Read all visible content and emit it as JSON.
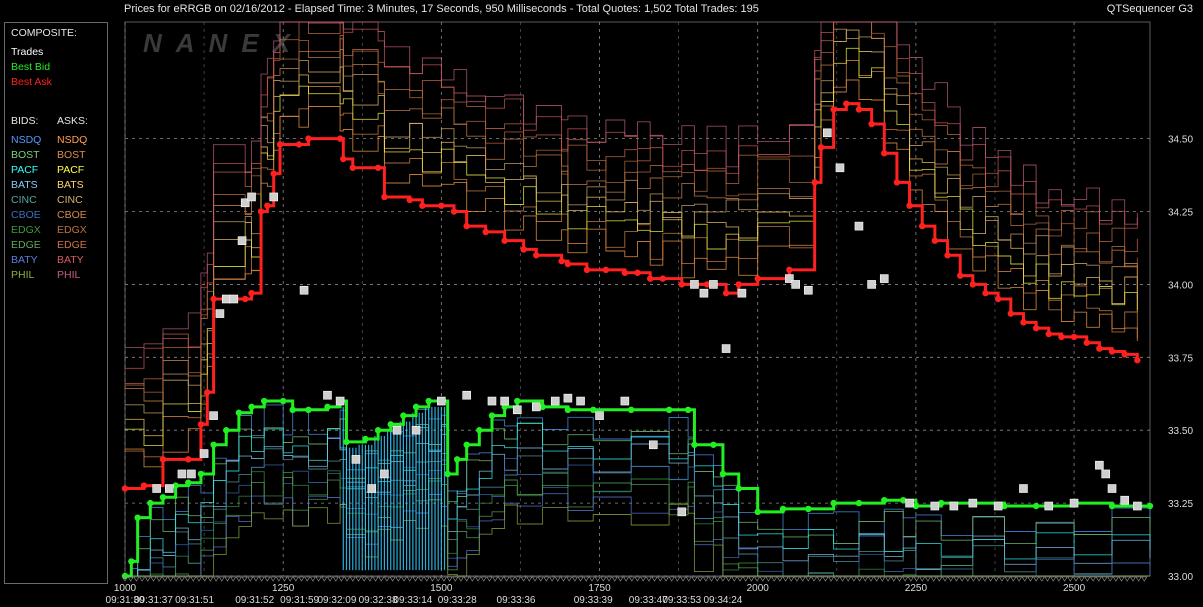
{
  "header": {
    "title": "Prices for  eRRGB  on  02/16/2012  -  Elapsed Time: 3 Minutes, 17 Seconds, 950 Milliseconds  -  Total Quotes: 1,502  Total Trades: 195",
    "app_name": "QTSequencer G3"
  },
  "watermark": "NANEX",
  "legend": {
    "composite_title": "COMPOSITE:",
    "composite_items": [
      {
        "label": "Trades",
        "color": "#ffffff"
      },
      {
        "label": "Best Bid",
        "color": "#22ee22"
      },
      {
        "label": "Best Ask",
        "color": "#ff2020"
      }
    ],
    "bids_title": "BIDS:",
    "asks_title": "ASKS:",
    "exchanges": [
      {
        "bid": "NSDQ",
        "ask": "NSDQ",
        "bid_color": "#4f9bff",
        "ask_color": "#ffa24a"
      },
      {
        "bid": "BOST",
        "ask": "BOST",
        "bid_color": "#7fd07f",
        "ask_color": "#e08a4a"
      },
      {
        "bid": "PACF",
        "ask": "PACF",
        "bid_color": "#33ffff",
        "ask_color": "#ffff44"
      },
      {
        "bid": "BATS",
        "ask": "BATS",
        "bid_color": "#88ccff",
        "ask_color": "#ffd36a"
      },
      {
        "bid": "CINC",
        "ask": "CINC",
        "bid_color": "#5aa6a6",
        "ask_color": "#d8b070"
      },
      {
        "bid": "CBOE",
        "ask": "CBOE",
        "bid_color": "#3a6fbf",
        "ask_color": "#d58a50"
      },
      {
        "bid": "EDGX",
        "ask": "EDGX",
        "bid_color": "#3e9a3e",
        "ask_color": "#c07040"
      },
      {
        "bid": "EDGE",
        "ask": "EDGE",
        "bid_color": "#5caa5c",
        "ask_color": "#d0704a"
      },
      {
        "bid": "BATY",
        "ask": "BATY",
        "bid_color": "#5d7ddd",
        "ask_color": "#d85a5a"
      },
      {
        "bid": "PHIL",
        "ask": "PHIL",
        "bid_color": "#8fb040",
        "ask_color": "#c06080"
      }
    ]
  },
  "chart_data": {
    "type": "line",
    "x_range": [
      1000,
      2620
    ],
    "ylim": [
      33.0,
      34.9
    ],
    "yticks": [
      33.0,
      33.25,
      33.5,
      33.75,
      34.0,
      34.25,
      34.5
    ],
    "ytick_labels": [
      "33.00",
      "33.25",
      "33.50",
      "33.75",
      "34.00",
      "34.25",
      "34.50"
    ],
    "xticks": [
      1000,
      1250,
      1500,
      1750,
      2000,
      2250,
      2500
    ],
    "xtick_labels": [
      "1000",
      "1250",
      "1500",
      "1750",
      "2000",
      "2250",
      "2500"
    ],
    "time_labels": [
      {
        "x": 1000,
        "label": "09:31:30"
      },
      {
        "x": 1045,
        "label": "09:31:37"
      },
      {
        "x": 1110,
        "label": "09:31:51"
      },
      {
        "x": 1205,
        "label": "09:31:52"
      },
      {
        "x": 1276,
        "label": "09:31:59"
      },
      {
        "x": 1335,
        "label": "09:32:09"
      },
      {
        "x": 1400,
        "label": "09:32:38"
      },
      {
        "x": 1455,
        "label": "09:33:14"
      },
      {
        "x": 1525,
        "label": "09:33:28"
      },
      {
        "x": 1618,
        "label": "09:33:36"
      },
      {
        "x": 1740,
        "label": "09:33:39"
      },
      {
        "x": 1827,
        "label": "09:33:47"
      },
      {
        "x": 1880,
        "label": "09:33:53"
      },
      {
        "x": 1945,
        "label": "09:34:24"
      }
    ],
    "grid": true,
    "series": [
      {
        "name": "Best Ask",
        "color": "#ff2020",
        "points": [
          [
            1000,
            33.3
          ],
          [
            1030,
            33.31
          ],
          [
            1060,
            33.4
          ],
          [
            1100,
            33.4
          ],
          [
            1120,
            33.52
          ],
          [
            1130,
            33.63
          ],
          [
            1140,
            33.95
          ],
          [
            1190,
            33.95
          ],
          [
            1200,
            33.97
          ],
          [
            1215,
            34.25
          ],
          [
            1225,
            34.27
          ],
          [
            1235,
            34.38
          ],
          [
            1245,
            34.48
          ],
          [
            1275,
            34.48
          ],
          [
            1290,
            34.5
          ],
          [
            1340,
            34.5
          ],
          [
            1345,
            34.43
          ],
          [
            1360,
            34.4
          ],
          [
            1400,
            34.4
          ],
          [
            1410,
            34.3
          ],
          [
            1450,
            34.29
          ],
          [
            1470,
            34.27
          ],
          [
            1500,
            34.27
          ],
          [
            1520,
            34.25
          ],
          [
            1540,
            34.2
          ],
          [
            1570,
            34.18
          ],
          [
            1600,
            34.15
          ],
          [
            1630,
            34.12
          ],
          [
            1650,
            34.1
          ],
          [
            1690,
            34.08
          ],
          [
            1700,
            34.07
          ],
          [
            1730,
            34.05
          ],
          [
            1760,
            34.05
          ],
          [
            1790,
            34.04
          ],
          [
            1810,
            34.04
          ],
          [
            1830,
            34.02
          ],
          [
            1850,
            34.02
          ],
          [
            1880,
            34.0
          ],
          [
            1900,
            34.0
          ],
          [
            1920,
            34.0
          ],
          [
            1950,
            33.97
          ],
          [
            1970,
            34.0
          ],
          [
            2000,
            34.02
          ],
          [
            2050,
            34.05
          ],
          [
            2090,
            34.35
          ],
          [
            2100,
            34.47
          ],
          [
            2120,
            34.6
          ],
          [
            2140,
            34.62
          ],
          [
            2160,
            34.6
          ],
          [
            2180,
            34.55
          ],
          [
            2200,
            34.45
          ],
          [
            2220,
            34.35
          ],
          [
            2240,
            34.27
          ],
          [
            2260,
            34.2
          ],
          [
            2280,
            34.15
          ],
          [
            2300,
            34.1
          ],
          [
            2320,
            34.03
          ],
          [
            2340,
            34.0
          ],
          [
            2360,
            33.97
          ],
          [
            2380,
            33.95
          ],
          [
            2400,
            33.9
          ],
          [
            2420,
            33.87
          ],
          [
            2440,
            33.85
          ],
          [
            2460,
            33.83
          ],
          [
            2480,
            33.82
          ],
          [
            2500,
            33.82
          ],
          [
            2520,
            33.8
          ],
          [
            2540,
            33.78
          ],
          [
            2560,
            33.77
          ],
          [
            2580,
            33.76
          ],
          [
            2600,
            33.74
          ]
        ]
      },
      {
        "name": "Best Bid",
        "color": "#22ee22",
        "points": [
          [
            1000,
            33.0
          ],
          [
            1010,
            33.05
          ],
          [
            1020,
            33.2
          ],
          [
            1040,
            33.25
          ],
          [
            1060,
            33.27
          ],
          [
            1080,
            33.31
          ],
          [
            1100,
            33.32
          ],
          [
            1120,
            33.35
          ],
          [
            1140,
            33.45
          ],
          [
            1160,
            33.5
          ],
          [
            1180,
            33.56
          ],
          [
            1200,
            33.58
          ],
          [
            1220,
            33.6
          ],
          [
            1250,
            33.6
          ],
          [
            1265,
            33.57
          ],
          [
            1290,
            33.57
          ],
          [
            1320,
            33.58
          ],
          [
            1340,
            33.6
          ],
          [
            1350,
            33.46
          ],
          [
            1380,
            33.47
          ],
          [
            1400,
            33.5
          ],
          [
            1420,
            33.52
          ],
          [
            1440,
            33.55
          ],
          [
            1460,
            33.58
          ],
          [
            1480,
            33.6
          ],
          [
            1500,
            33.6
          ],
          [
            1510,
            33.35
          ],
          [
            1525,
            33.4
          ],
          [
            1540,
            33.45
          ],
          [
            1560,
            33.5
          ],
          [
            1580,
            33.55
          ],
          [
            1600,
            33.58
          ],
          [
            1620,
            33.6
          ],
          [
            1660,
            33.58
          ],
          [
            1700,
            33.57
          ],
          [
            1740,
            33.57
          ],
          [
            1800,
            33.57
          ],
          [
            1860,
            33.57
          ],
          [
            1890,
            33.57
          ],
          [
            1900,
            33.45
          ],
          [
            1930,
            33.45
          ],
          [
            1945,
            33.35
          ],
          [
            1970,
            33.3
          ],
          [
            2000,
            33.22
          ],
          [
            2040,
            33.23
          ],
          [
            2080,
            33.23
          ],
          [
            2120,
            33.25
          ],
          [
            2160,
            33.25
          ],
          [
            2200,
            33.26
          ],
          [
            2230,
            33.26
          ],
          [
            2250,
            33.24
          ],
          [
            2290,
            33.25
          ],
          [
            2340,
            33.25
          ],
          [
            2390,
            33.24
          ],
          [
            2440,
            33.24
          ],
          [
            2500,
            33.25
          ],
          [
            2560,
            33.24
          ],
          [
            2620,
            33.24
          ]
        ]
      },
      {
        "name": "Trades",
        "color": "#ffffff",
        "points": [
          [
            1050,
            33.3
          ],
          [
            1070,
            33.3
          ],
          [
            1090,
            33.35
          ],
          [
            1105,
            33.35
          ],
          [
            1125,
            33.42
          ],
          [
            1140,
            33.55
          ],
          [
            1150,
            33.9
          ],
          [
            1160,
            33.95
          ],
          [
            1172,
            33.95
          ],
          [
            1185,
            34.15
          ],
          [
            1190,
            34.28
          ],
          [
            1200,
            34.3
          ],
          [
            1235,
            34.3
          ],
          [
            1283,
            33.98
          ],
          [
            1320,
            33.62
          ],
          [
            1340,
            33.6
          ],
          [
            1365,
            33.4
          ],
          [
            1390,
            33.3
          ],
          [
            1410,
            33.35
          ],
          [
            1430,
            33.5
          ],
          [
            1460,
            33.5
          ],
          [
            1500,
            33.6
          ],
          [
            1540,
            33.62
          ],
          [
            1580,
            33.6
          ],
          [
            1600,
            33.6
          ],
          [
            1620,
            33.57
          ],
          [
            1650,
            33.58
          ],
          [
            1680,
            33.6
          ],
          [
            1700,
            33.61
          ],
          [
            1720,
            33.6
          ],
          [
            1750,
            33.55
          ],
          [
            1790,
            33.6
          ],
          [
            1835,
            33.45
          ],
          [
            1880,
            33.22
          ],
          [
            1900,
            34.0
          ],
          [
            1915,
            33.97
          ],
          [
            1930,
            34.0
          ],
          [
            1950,
            33.78
          ],
          [
            1975,
            33.97
          ],
          [
            2050,
            34.02
          ],
          [
            2060,
            34.0
          ],
          [
            2080,
            33.98
          ],
          [
            2110,
            34.52
          ],
          [
            2130,
            34.4
          ],
          [
            2160,
            34.2
          ],
          [
            2180,
            34.0
          ],
          [
            2200,
            34.02
          ],
          [
            2240,
            33.25
          ],
          [
            2280,
            33.24
          ],
          [
            2310,
            33.24
          ],
          [
            2340,
            33.25
          ],
          [
            2380,
            33.24
          ],
          [
            2420,
            33.3
          ],
          [
            2460,
            33.24
          ],
          [
            2500,
            33.25
          ],
          [
            2540,
            33.38
          ],
          [
            2550,
            33.35
          ],
          [
            2560,
            33.3
          ],
          [
            2580,
            33.26
          ],
          [
            2600,
            33.24
          ]
        ]
      }
    ]
  }
}
